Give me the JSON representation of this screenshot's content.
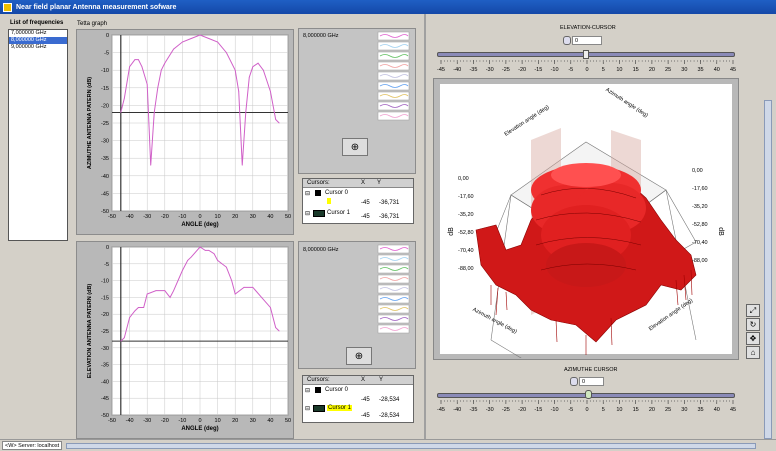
{
  "window": {
    "title": "Near field planar Antenna measurement sofware"
  },
  "frequencies": {
    "label": "List of frequencies",
    "items": [
      "7,000000 GHz",
      "8,000000 GHz",
      "9,000000 GHz"
    ],
    "selected_index": 1
  },
  "top_graph": {
    "caption": "Tetta graph",
    "ylabel": "AZIMUTHE ANTENNA PATERN (dB)",
    "xlabel": "ANGLE (deg)",
    "yticks": [
      "0",
      "-5",
      "-10",
      "-15",
      "-20",
      "-25",
      "-30",
      "-35",
      "-40",
      "-45",
      "-50"
    ],
    "xticks": [
      "-50",
      "-40",
      "-30",
      "-20",
      "-10",
      "0",
      "10",
      "20",
      "30",
      "40",
      "50"
    ],
    "freq_label": "8,000000 GHz"
  },
  "bottom_graph": {
    "ylabel": "ELEVATION ANTENNA PATERN (dB)",
    "xlabel": "ANGLE (deg)",
    "yticks": [
      "0",
      "-5",
      "-10",
      "-15",
      "-20",
      "-25",
      "-30",
      "-35",
      "-40",
      "-45",
      "-50"
    ],
    "xticks": [
      "-50",
      "-40",
      "-30",
      "-20",
      "-10",
      "0",
      "10",
      "20",
      "30",
      "40",
      "50"
    ],
    "freq_label": "8,000000 GHz"
  },
  "top_cursors": {
    "header": {
      "name": "Cursors:",
      "x": "X",
      "y": "Y"
    },
    "rows": [
      {
        "name": "Cursor 0",
        "x": "",
        "y": ""
      },
      {
        "name": "Cursor 1",
        "x": "-45",
        "y": "-36,731"
      }
    ],
    "row0_x": "-45",
    "row0_y": "-36,731"
  },
  "bottom_cursors": {
    "header": {
      "name": "Cursors:",
      "x": "X",
      "y": "Y"
    },
    "rows": [
      {
        "name": "Cursor 0",
        "x": "",
        "y": ""
      },
      {
        "name": "Cursor 1",
        "x": "-45",
        "y": "-28,534"
      }
    ],
    "row0_x": "-45",
    "row0_y": "-28,534"
  },
  "elevation_cursor": {
    "label": "ELEVATION-CURSOR",
    "value": "0"
  },
  "azimuthe_cursor": {
    "label": "AZIMUTHE CURSOR",
    "value": "0"
  },
  "slider_scale": [
    "-45",
    "-40",
    "-35",
    "-30",
    "-25",
    "-20",
    "-15",
    "-10",
    "-5",
    "0",
    "5",
    "10",
    "15",
    "20",
    "25",
    "30",
    "35",
    "40",
    "45"
  ],
  "plot3d": {
    "zlabel": "dB",
    "axis_elev_top": "Elevation angle (deg)",
    "axis_az_top": "Azimuth angle (deg)",
    "axis_az_bottom": "Azimuth angle (deg)",
    "axis_elev_bottom": "Elevation angle (deg)",
    "left_ticks": [
      "0,00",
      "-17,60",
      "-35,20",
      "-52,80",
      "-70,40",
      "-88,00"
    ],
    "right_ticks": [
      "0,00",
      "-17,60",
      "-35,20",
      "-52,80",
      "-70,40",
      "-88,00"
    ]
  },
  "status": {
    "text": "<W> Server: localhost"
  },
  "chart_data": [
    {
      "type": "line",
      "name": "azimuth",
      "xlim": [
        -50,
        50
      ],
      "ylim": [
        -50,
        0
      ],
      "x": [
        -45,
        -43,
        -40,
        -37,
        -35,
        -33,
        -30,
        -28,
        -26,
        -24,
        -22,
        -20,
        -15,
        -10,
        -5,
        0,
        5,
        10,
        15,
        20,
        22,
        24,
        26,
        28,
        30,
        33,
        36,
        40,
        43,
        45
      ],
      "y": [
        -22,
        -18,
        -9,
        -7,
        -7,
        -9,
        -14,
        -37,
        -22,
        -15,
        -10,
        -8,
        -4,
        -2,
        -1,
        0,
        -1,
        -2,
        -5,
        -10,
        -16,
        -37,
        -22,
        -12,
        -9,
        -8,
        -10,
        -16,
        -24,
        -25
      ]
    },
    {
      "type": "line",
      "name": "elevation",
      "xlim": [
        -50,
        50
      ],
      "ylim": [
        -50,
        0
      ],
      "x": [
        -45,
        -43,
        -40,
        -37,
        -35,
        -32,
        -30,
        -25,
        -20,
        -17,
        -15,
        -10,
        -7,
        -5,
        0,
        3,
        5,
        8,
        10,
        15,
        18,
        20,
        25,
        30,
        35,
        40,
        43,
        45
      ],
      "y": [
        -28,
        -27,
        -21,
        -19,
        -18,
        -18,
        -14,
        -13,
        -13,
        -15,
        -13,
        -7,
        -4,
        -3,
        0,
        -1,
        -1,
        -2,
        -4,
        -6,
        -10,
        -14,
        -12,
        -12,
        -15,
        -18,
        -24,
        -25
      ]
    }
  ]
}
